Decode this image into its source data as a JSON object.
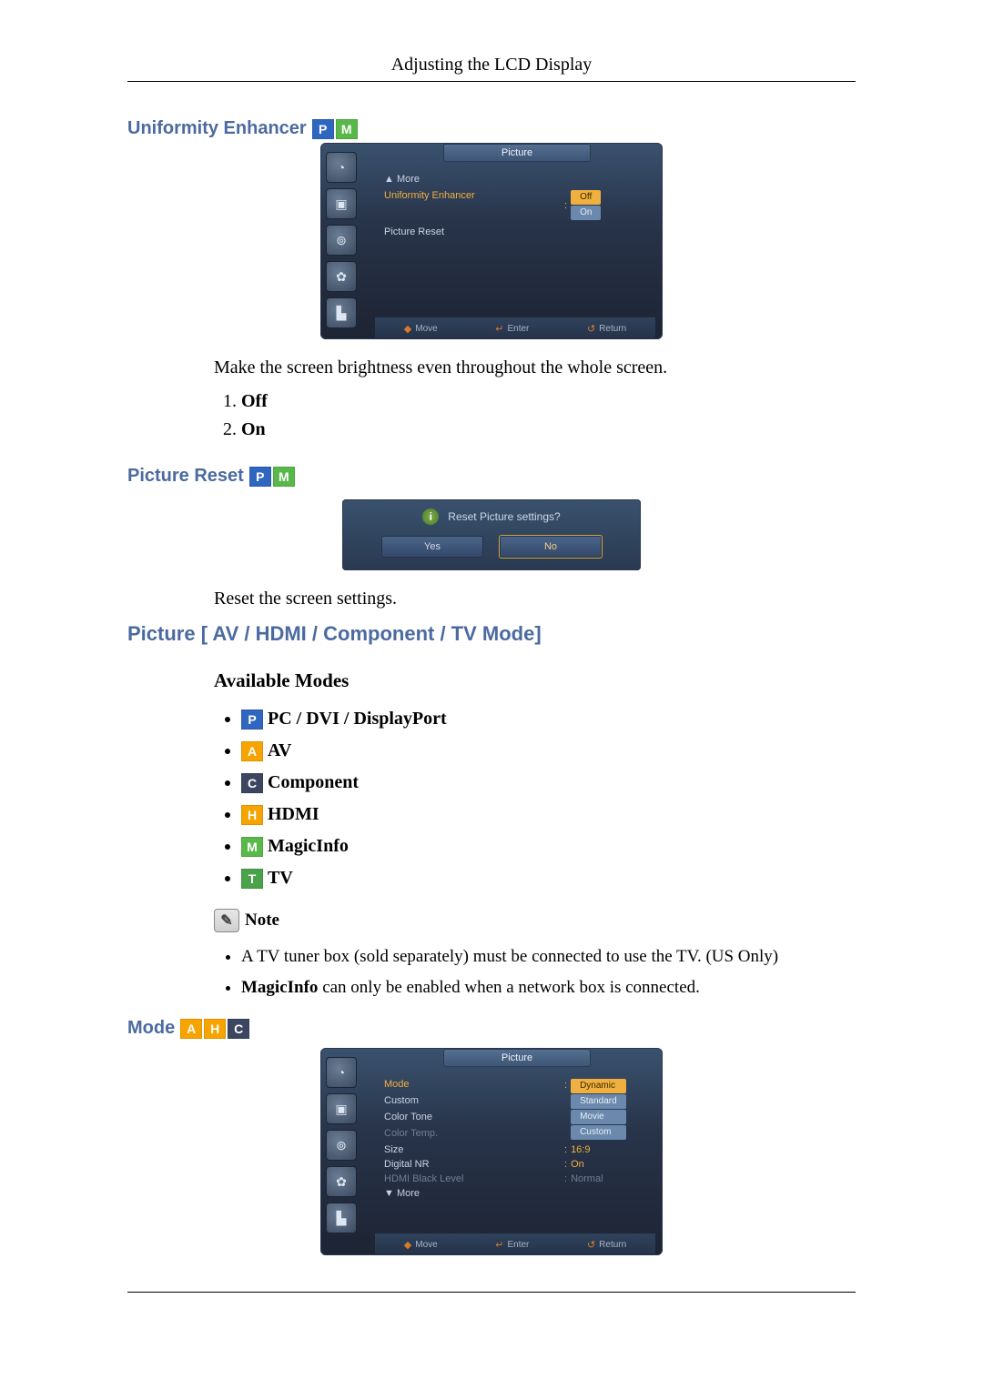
{
  "header": {
    "title": "Adjusting the LCD Display"
  },
  "badges": {
    "P": "P",
    "A": "A",
    "C": "C",
    "H": "H",
    "M": "M",
    "T": "T"
  },
  "uniformity": {
    "title": "Uniformity Enhancer",
    "osd": {
      "title": "Picture",
      "more": "▲ More",
      "row_enhancer": "Uniformity Enhancer",
      "row_reset": "Picture Reset",
      "val_off": "Off",
      "val_on": "On",
      "footer": {
        "move": "Move",
        "enter": "Enter",
        "return": "Return"
      }
    },
    "desc": "Make the screen brightness even throughout the whole screen.",
    "options": [
      "Off",
      "On"
    ]
  },
  "picture_reset": {
    "title": "Picture Reset",
    "dialog": {
      "question": "Reset Picture settings?",
      "yes": "Yes",
      "no": "No"
    },
    "desc": "Reset the screen settings."
  },
  "picture_av": {
    "title": "Picture [ AV / HDMI / Component / TV Mode]",
    "available_heading": "Available Modes",
    "modes": {
      "pc": "PC / DVI / DisplayPort",
      "av": "AV",
      "component": "Component",
      "hdmi": "HDMI",
      "magicinfo": "MagicInfo",
      "tv": "TV"
    },
    "note_label": "Note",
    "notes": {
      "tv_tuner": "A TV tuner box (sold separately) must be connected to use the TV. (US Only)",
      "magicinfo_prefix": "MagicInfo",
      "magicinfo_rest": " can only be enabled when a network box is connected."
    }
  },
  "mode_section": {
    "title": "Mode",
    "osd": {
      "title": "Picture",
      "rows": {
        "mode": "Mode",
        "custom": "Custom",
        "color_tone": "Color Tone",
        "color_temp": "Color Temp.",
        "size": "Size",
        "digital_nr": "Digital NR",
        "hdmi_black": "HDMI Black Level",
        "more": "▼ More"
      },
      "vals": {
        "dynamic": "Dynamic",
        "standard": "Standard",
        "movie": "Movie",
        "custom": "Custom",
        "size": "16:9",
        "digital_nr": "On",
        "hdmi_black": "Normal"
      },
      "footer": {
        "move": "Move",
        "enter": "Enter",
        "return": "Return"
      }
    }
  }
}
